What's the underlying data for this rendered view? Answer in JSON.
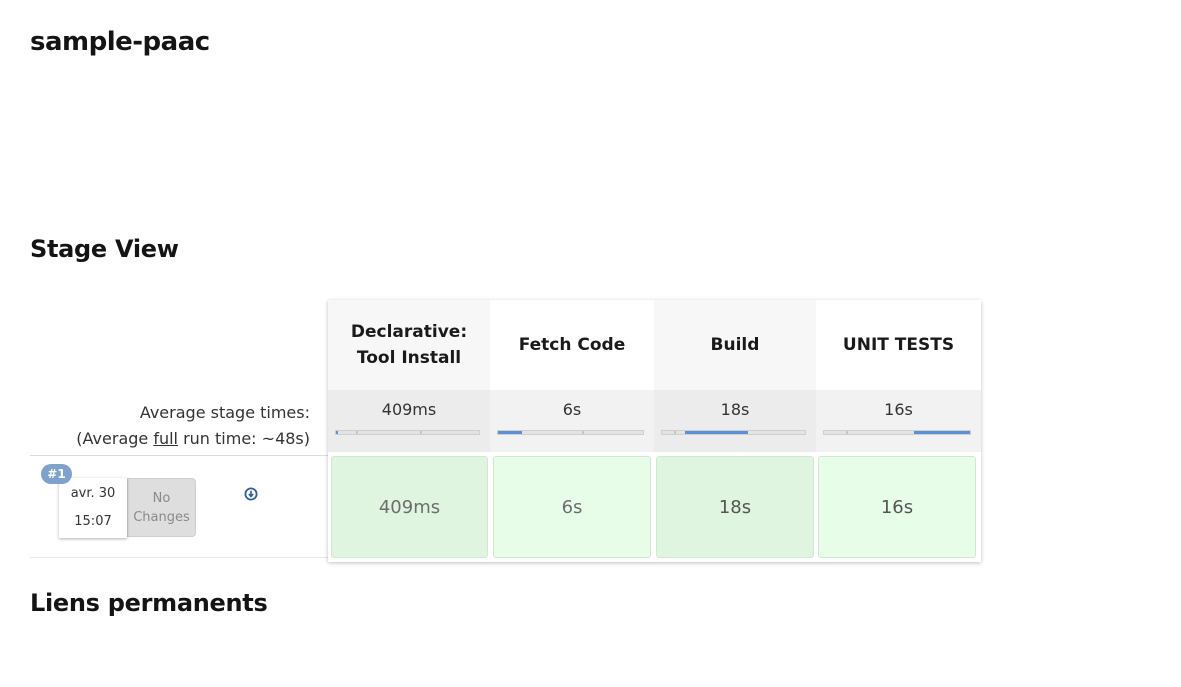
{
  "page": {
    "title": "sample-paac"
  },
  "sections": {
    "stage_view": "Stage View",
    "permalinks": "Liens permanents"
  },
  "colors": {
    "success_cell": "#dff5df",
    "success_cell_alt": "#e8fde8",
    "progress_fill": "#5b8fd6",
    "badge": "#7ea2cc"
  },
  "stage_view": {
    "avg_label_line1": "Average stage times:",
    "avg_label_prefix": "(Average ",
    "avg_label_link": "full",
    "avg_label_suffix": " run time: ~48s)",
    "stages": [
      {
        "name_line1": "Declarative:",
        "name_line2": "Tool Install",
        "avg": "409ms",
        "avg_fraction": 0.01
      },
      {
        "name_line1": "Fetch Code",
        "name_line2": "",
        "avg": "6s",
        "avg_fraction": 0.17
      },
      {
        "name_line1": "Build",
        "name_line2": "",
        "avg": "18s",
        "avg_fraction": 0.45
      },
      {
        "name_line1": "UNIT TESTS",
        "name_line2": "",
        "avg": "16s",
        "avg_fraction": 0.4
      }
    ],
    "runs": [
      {
        "badge": "#1",
        "date": "avr. 30",
        "time": "15:07",
        "changes_line1": "No",
        "changes_line2": "Changes",
        "icon": "download-icon",
        "durations": [
          "409ms",
          "6s",
          "18s",
          "16s"
        ]
      }
    ]
  }
}
